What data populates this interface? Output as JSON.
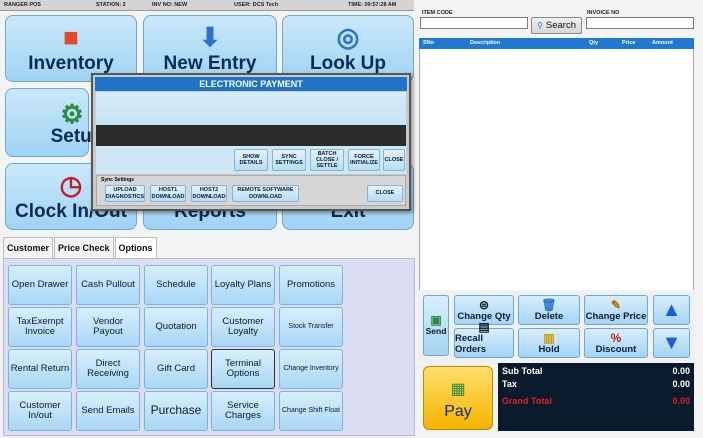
{
  "status_bar": {
    "pos": "RANGER POS",
    "station": "STATION: 2",
    "invoice": "INV NO: NEW",
    "user": "USER: DCS Tech",
    "time": "TIME: 09:57:28 AM"
  },
  "tiles": {
    "inventory": "Inventory",
    "new_entry": "New Entry",
    "look_up": "Look Up",
    "setup": "Setup",
    "clock": "Clock In/Out",
    "reports": "Reports",
    "exit": "Exit"
  },
  "tabs": [
    "Customer",
    "Price Check",
    "Options"
  ],
  "options": [
    [
      "Open Drawer",
      "Cash Pullout",
      "Schedule",
      "Loyalty Plans",
      "Promotions"
    ],
    [
      "TaxExempt Invoice",
      "Vendor Payout",
      "Quotation",
      "Customer Loyalty",
      "Stock Transfer"
    ],
    [
      "Rental Return",
      "Direct Receiving",
      "Gift Card",
      "Terminal Options",
      "Change Inventory"
    ],
    [
      "Customer In/out",
      "Send Emails",
      "Purchase",
      "Service Charges",
      "Change Shift Float"
    ]
  ],
  "dialog": {
    "title": "ELECTRONIC PAYMENT",
    "buttons": [
      "SHOW DETAILS",
      "SYNC SETTINGS",
      "BATCH CLOSE / SETTLE",
      "FORCE INITIALIZE",
      "CLOSE"
    ],
    "sync_label": "Sync Settings",
    "sync_buttons": [
      "UPLOAD DIAGNOSTICS",
      "HOST1 DOWNLOAD",
      "HOST2 DOWNLOAD",
      "REMOTE SOFTWARE DOWNLOAD",
      "CLOSE"
    ]
  },
  "right": {
    "item_code_label": "ITEM CODE",
    "invoice_no_label": "INVOICE NO",
    "search_label": "Search",
    "columns": [
      "SNo",
      "Description",
      "Qty",
      "Price",
      "Amount"
    ]
  },
  "actions": {
    "send": "Send",
    "change_qty": "Change Qty",
    "delete": "Delete",
    "change_price": "Change Price",
    "recall_orders": "Recall Orders",
    "hold": "Hold",
    "discount": "Discount"
  },
  "pay": "Pay",
  "totals": {
    "sub_total_label": "Sub Total",
    "sub_total": "0.00",
    "tax_label": "Tax",
    "tax": "0.00",
    "grand_total_label": "Grand Total",
    "grand_total": "0.00"
  },
  "colors": {
    "accent_blue": "#1f78d1",
    "pay_yellow": "#f4b400",
    "grand_total_red": "#e02020"
  }
}
